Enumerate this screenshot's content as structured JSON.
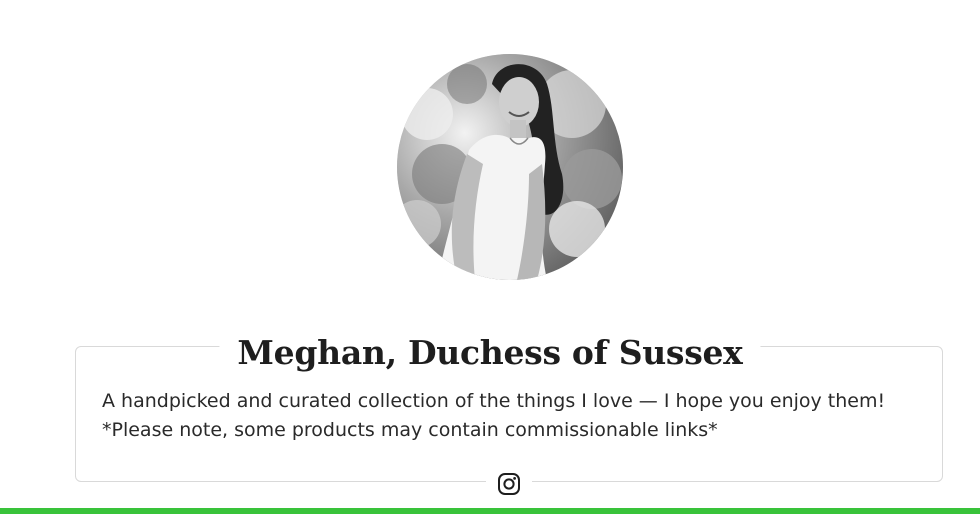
{
  "profile": {
    "name": "Meghan, Duchess of Sussex",
    "bio": "A handpicked and curated collection of the things I love — I hope you enjoy them! *Please note, some products may contain commissionable links*",
    "avatar_icon": "profile-photo",
    "social": [
      {
        "icon": "instagram-icon"
      }
    ]
  },
  "colors": {
    "accent_strip": "#39c33a",
    "card_border": "#d9d9d9",
    "text": "#1e1e1e"
  }
}
